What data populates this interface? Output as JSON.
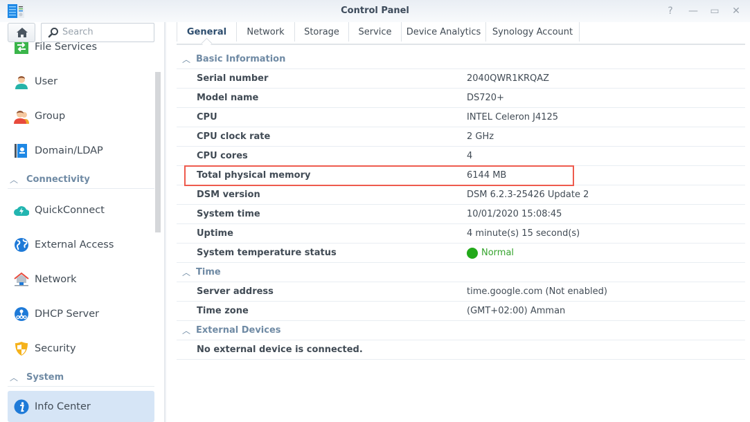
{
  "window": {
    "title": "Control Panel",
    "controls": [
      {
        "name": "help",
        "glyph": "?"
      },
      {
        "name": "minimize",
        "glyph": "—"
      },
      {
        "name": "maximize",
        "glyph": "▭"
      },
      {
        "name": "close",
        "glyph": "✕"
      }
    ]
  },
  "sidebar": {
    "search_placeholder": "Search",
    "items": [
      {
        "label": "File Services",
        "icon": "file-services-icon"
      },
      {
        "label": "User",
        "icon": "user-icon"
      },
      {
        "label": "Group",
        "icon": "group-icon"
      },
      {
        "label": "Domain/LDAP",
        "icon": "domain-ldap-icon"
      },
      {
        "label": "QuickConnect",
        "icon": "quickconnect-icon"
      },
      {
        "label": "External Access",
        "icon": "external-access-icon"
      },
      {
        "label": "Network",
        "icon": "network-icon"
      },
      {
        "label": "DHCP Server",
        "icon": "dhcp-server-icon"
      },
      {
        "label": "Security",
        "icon": "security-icon"
      },
      {
        "label": "Info Center",
        "icon": "info-center-icon",
        "active": true
      }
    ],
    "sections": [
      {
        "label": "Connectivity"
      },
      {
        "label": "System"
      }
    ]
  },
  "tabs": [
    {
      "label": "General",
      "active": true
    },
    {
      "label": "Network"
    },
    {
      "label": "Storage"
    },
    {
      "label": "Service"
    },
    {
      "label": "Device Analytics"
    },
    {
      "label": "Synology Account"
    }
  ],
  "general": {
    "basic_information": {
      "title": "Basic Information",
      "rows": [
        {
          "key": "Serial number",
          "value": "2040QWR1KRQAZ"
        },
        {
          "key": "Model name",
          "value": "DS720+"
        },
        {
          "key": "CPU",
          "value": "INTEL Celeron J4125"
        },
        {
          "key": "CPU clock rate",
          "value": "2 GHz"
        },
        {
          "key": "CPU cores",
          "value": "4"
        },
        {
          "key": "Total physical memory",
          "value": "6144 MB",
          "highlighted": true
        },
        {
          "key": "DSM version",
          "value": "DSM 6.2.3-25426 Update 2"
        },
        {
          "key": "System time",
          "value": "10/01/2020 15:08:45"
        },
        {
          "key": "Uptime",
          "value": "4 minute(s) 15 second(s)"
        },
        {
          "key": "System temperature status",
          "value": "Normal",
          "status_color": "#22a91a"
        }
      ]
    },
    "time": {
      "title": "Time",
      "rows": [
        {
          "key": "Server address",
          "value": "time.google.com (Not enabled)"
        },
        {
          "key": "Time zone",
          "value": "(GMT+02:00) Amman"
        }
      ]
    },
    "external_devices": {
      "title": "External Devices",
      "message": "No external device is connected."
    }
  },
  "colors": {
    "accent": "#2d4d6e",
    "section_header": "#6f8aa4",
    "active_item_bg": "#d6e5f6",
    "highlight_border": "#ee5a4d",
    "status_ok": "#22a91a"
  }
}
